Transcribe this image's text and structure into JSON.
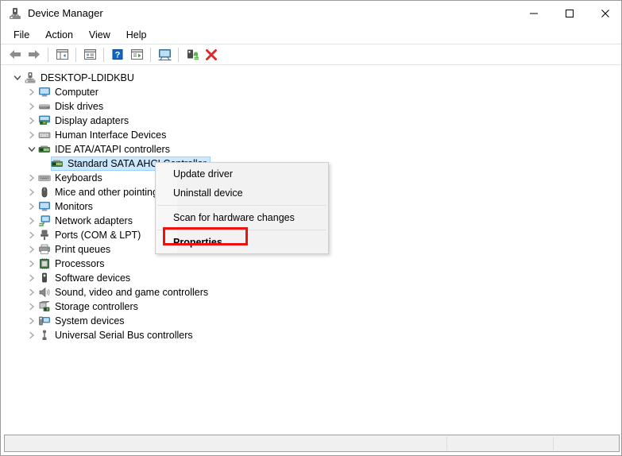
{
  "window": {
    "title": "Device Manager",
    "icon": "device-manager-icon",
    "controls": {
      "minimize": "–",
      "maximize": "□",
      "close": "✕"
    }
  },
  "menubar": {
    "items": [
      {
        "label": "File"
      },
      {
        "label": "Action"
      },
      {
        "label": "View"
      },
      {
        "label": "Help"
      }
    ]
  },
  "toolbar": {
    "buttons": [
      {
        "name": "back-icon",
        "title": "Back"
      },
      {
        "name": "forward-icon",
        "title": "Forward"
      },
      {
        "name": "separator",
        "title": ""
      },
      {
        "name": "show-hide-console-tree-icon",
        "title": "Show/Hide Console Tree"
      },
      {
        "name": "separator",
        "title": ""
      },
      {
        "name": "properties-icon",
        "title": "Properties"
      },
      {
        "name": "separator",
        "title": ""
      },
      {
        "name": "help-icon",
        "title": "Help"
      },
      {
        "name": "update-driver-icon",
        "title": "Update Driver"
      },
      {
        "name": "separator",
        "title": ""
      },
      {
        "name": "scan-for-hardware-changes-icon",
        "title": "Scan for hardware changes"
      },
      {
        "name": "separator",
        "title": ""
      },
      {
        "name": "enable-device-icon",
        "title": "Enable device"
      },
      {
        "name": "uninstall-device-icon",
        "title": "Uninstall device"
      }
    ]
  },
  "tree": {
    "root": {
      "label": "DESKTOP-LDIDKBU",
      "icon": "computer-root-icon",
      "expanded": true
    },
    "nodes": [
      {
        "label": "Computer",
        "icon": "computer-icon",
        "expanded": false,
        "level": 1
      },
      {
        "label": "Disk drives",
        "icon": "disk-drive-icon",
        "expanded": false,
        "level": 1
      },
      {
        "label": "Display adapters",
        "icon": "display-adapter-icon",
        "expanded": false,
        "level": 1
      },
      {
        "label": "Human Interface Devices",
        "icon": "hid-icon",
        "expanded": false,
        "level": 1
      },
      {
        "label": "IDE ATA/ATAPI controllers",
        "icon": "ide-controller-icon",
        "expanded": true,
        "level": 1
      },
      {
        "label": "Standard SATA AHCI Controller",
        "icon": "sata-controller-icon",
        "expanded": null,
        "level": 2,
        "selected": true
      },
      {
        "label": "Keyboards",
        "icon": "keyboard-icon",
        "expanded": false,
        "level": 1
      },
      {
        "label": "Mice and other pointing devices",
        "icon": "mouse-icon",
        "expanded": false,
        "level": 1
      },
      {
        "label": "Monitors",
        "icon": "monitor-icon",
        "expanded": false,
        "level": 1
      },
      {
        "label": "Network adapters",
        "icon": "network-adapter-icon",
        "expanded": false,
        "level": 1
      },
      {
        "label": "Ports (COM & LPT)",
        "icon": "port-icon",
        "expanded": false,
        "level": 1
      },
      {
        "label": "Print queues",
        "icon": "printer-icon",
        "expanded": false,
        "level": 1
      },
      {
        "label": "Processors",
        "icon": "processor-icon",
        "expanded": false,
        "level": 1
      },
      {
        "label": "Software devices",
        "icon": "software-device-icon",
        "expanded": false,
        "level": 1
      },
      {
        "label": "Sound, video and game controllers",
        "icon": "sound-icon",
        "expanded": false,
        "level": 1
      },
      {
        "label": "Storage controllers",
        "icon": "storage-controller-icon",
        "expanded": false,
        "level": 1
      },
      {
        "label": "System devices",
        "icon": "system-device-icon",
        "expanded": false,
        "level": 1
      },
      {
        "label": "Universal Serial Bus controllers",
        "icon": "usb-controller-icon",
        "expanded": false,
        "level": 1
      }
    ]
  },
  "context_menu": {
    "items": [
      {
        "label": "Update driver",
        "bold": false,
        "type": "item"
      },
      {
        "label": "Uninstall device",
        "bold": false,
        "type": "item"
      },
      {
        "label": "",
        "bold": false,
        "type": "separator"
      },
      {
        "label": "Scan for hardware changes",
        "bold": false,
        "type": "item"
      },
      {
        "label": "",
        "bold": false,
        "type": "separator"
      },
      {
        "label": "Properties",
        "bold": true,
        "type": "item"
      }
    ]
  },
  "annotation": {
    "highlight_color": "#ee1111",
    "target": "Properties"
  },
  "statusbar": {
    "panes": [
      "",
      "",
      ""
    ]
  },
  "colors": {
    "selection": "#cce8ff",
    "menu_background": "#f2f2f2",
    "window_background": "#ffffff",
    "statusbar_background": "#f0f0f0"
  }
}
